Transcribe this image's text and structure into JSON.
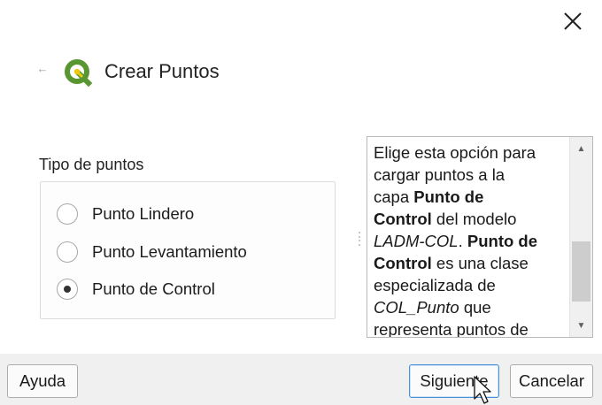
{
  "window": {
    "close_icon": "close-icon"
  },
  "header": {
    "back_icon": "back-arrow-icon",
    "back_glyph": "←",
    "logo_icon": "qgis-logo-icon",
    "title": "Crear Puntos"
  },
  "point_type": {
    "label": "Tipo de puntos",
    "options": [
      {
        "label": "Punto Lindero",
        "checked": false
      },
      {
        "label": "Punto Levantamiento",
        "checked": false
      },
      {
        "label": "Punto de Control",
        "checked": true
      }
    ]
  },
  "help": {
    "lines": [
      "Elige esta opción para",
      "cargar puntos a la",
      "capa ",
      "Punto de",
      "Control",
      " del modelo",
      "LADM-COL",
      ". ",
      "Punto de",
      "Control",
      " es una clase",
      "especializada de",
      "COL_Punto",
      " que",
      "representa puntos de"
    ],
    "scroll_up_icon": "scroll-up-icon",
    "scroll_down_icon": "scroll-down-icon"
  },
  "footer": {
    "help_label": "Ayuda",
    "next_label": "Siguiente",
    "cancel_label": "Cancelar"
  },
  "colors": {
    "accent_focus": "#4a90d9",
    "footer_bg": "#f0f0f0",
    "qgis_green": "#589632",
    "qgis_yellow": "#eec90d"
  }
}
